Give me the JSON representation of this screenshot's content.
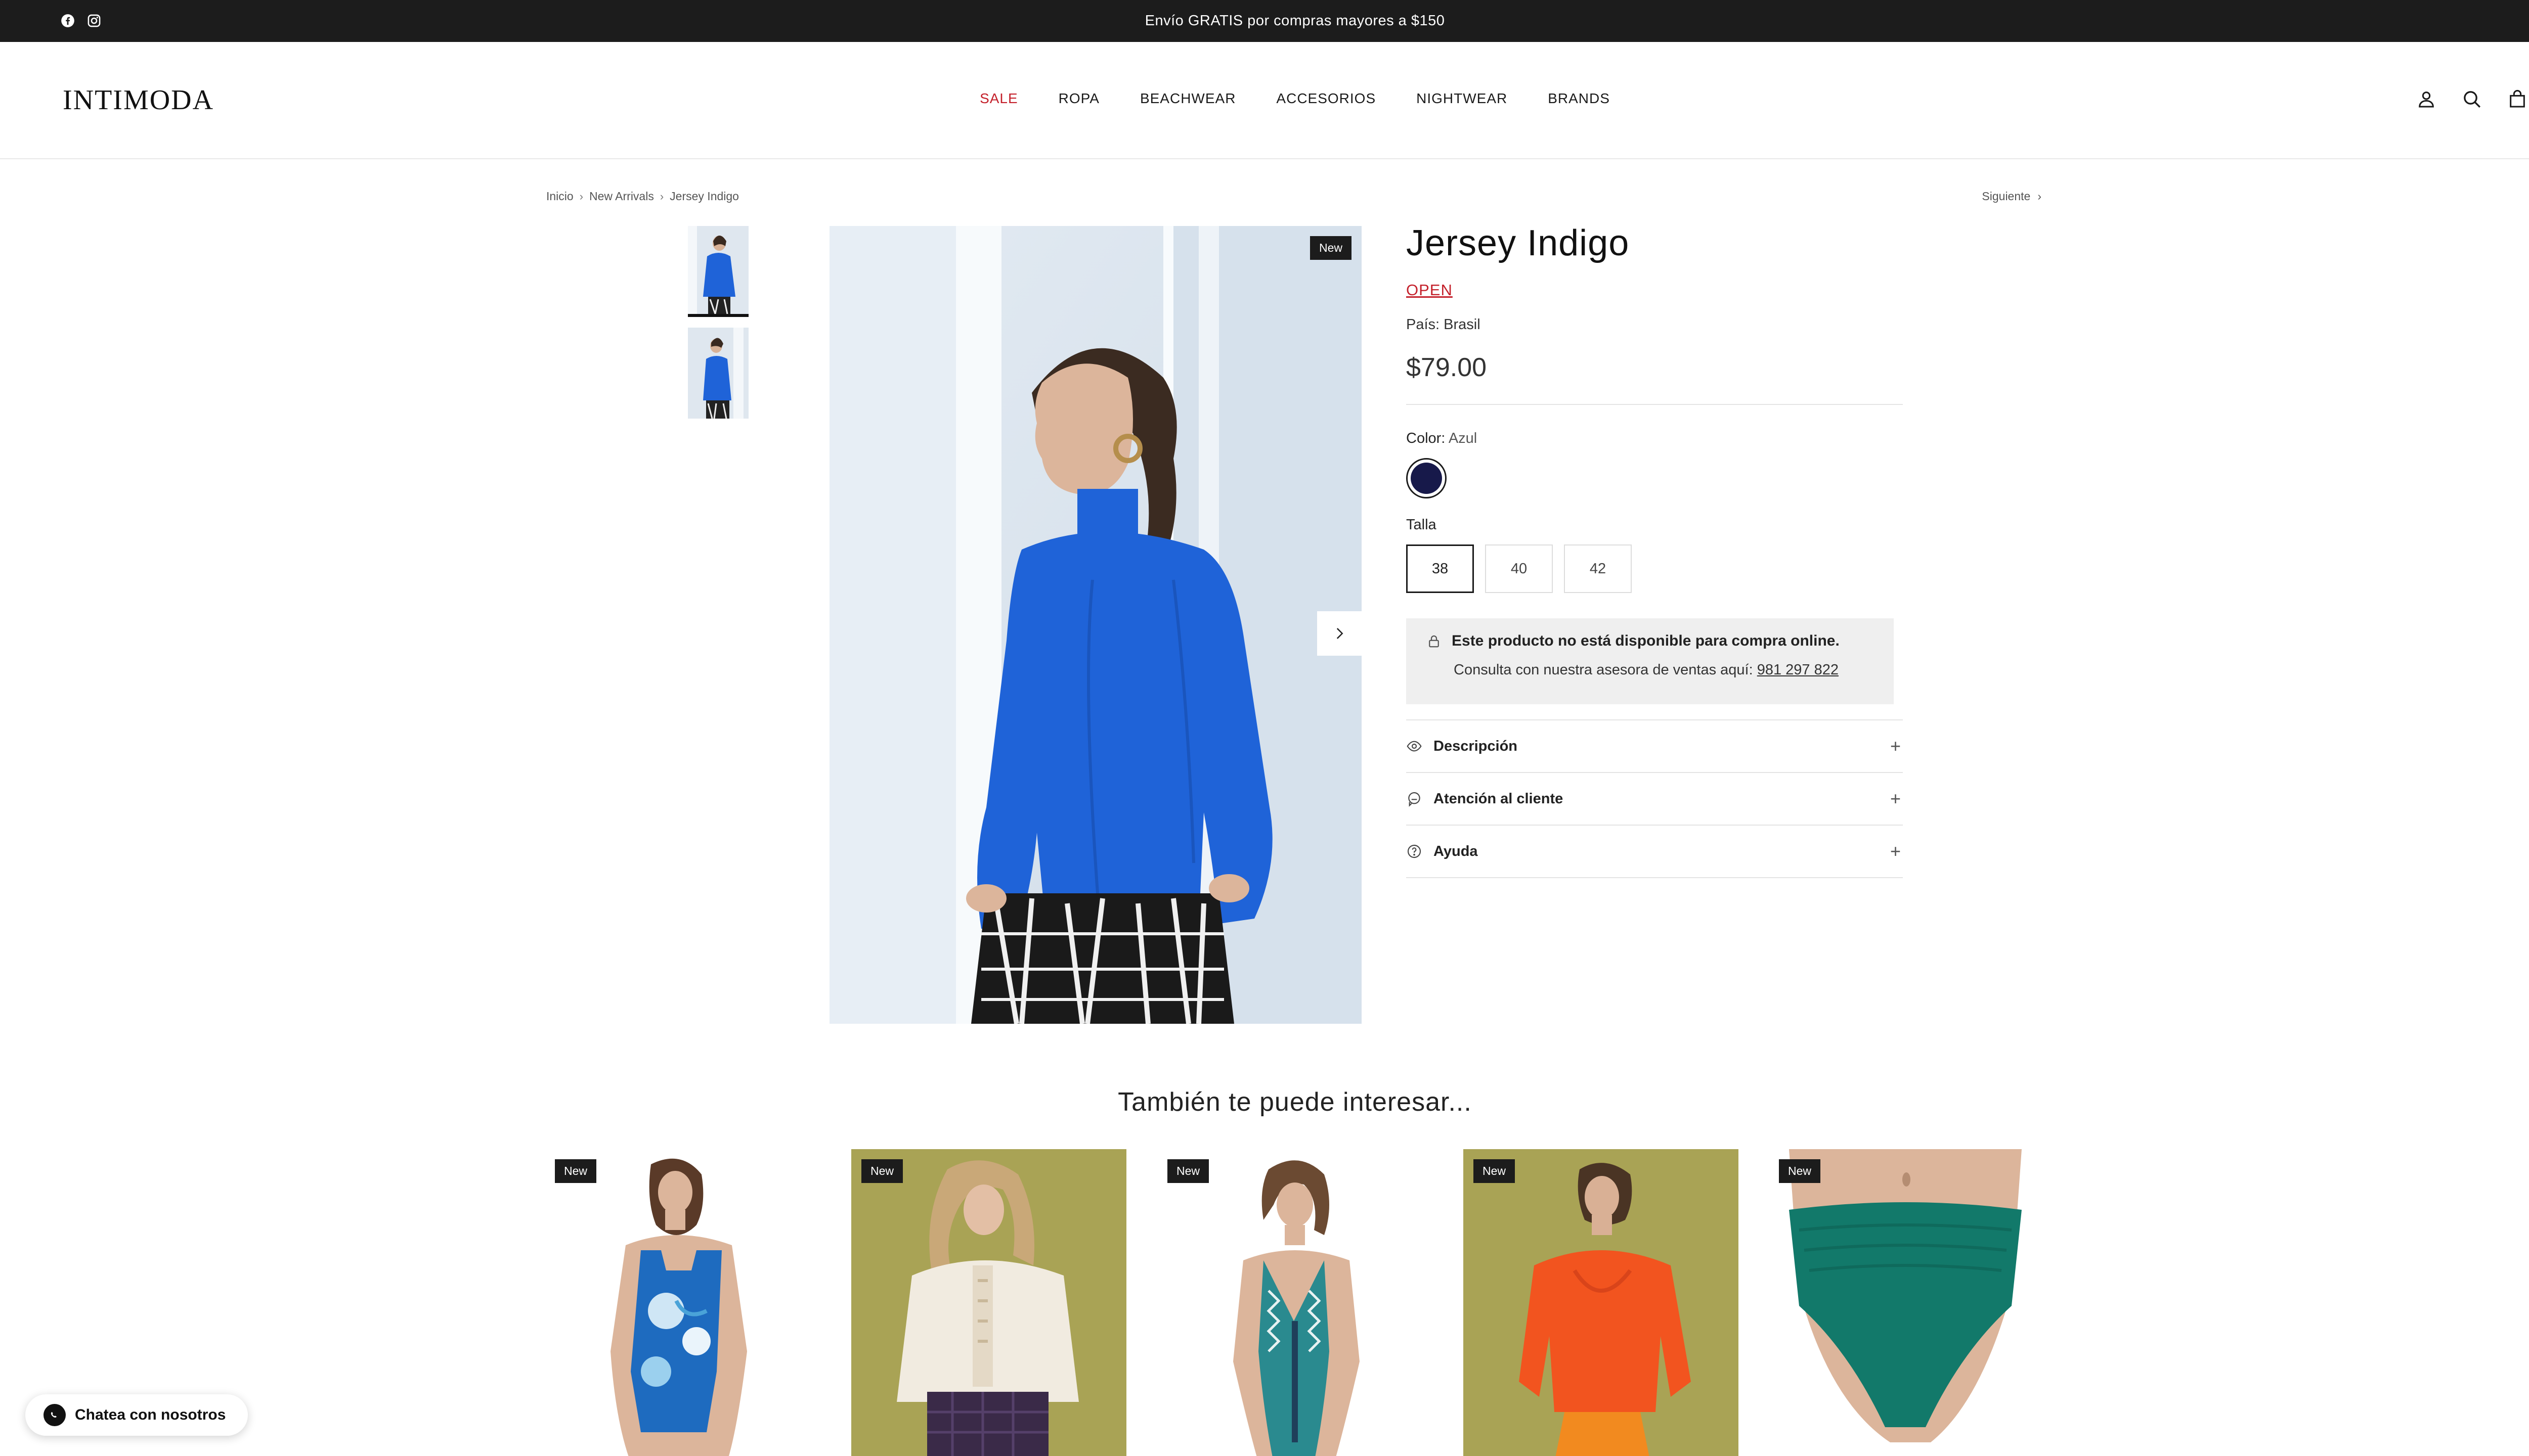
{
  "topbar": {
    "promo": "Envío GRATIS por compras mayores a $150",
    "social": [
      "facebook-icon",
      "instagram-icon"
    ]
  },
  "header": {
    "logo": "INTIMODA",
    "nav": [
      {
        "label": "SALE"
      },
      {
        "label": "ROPA"
      },
      {
        "label": "BEACHWEAR"
      },
      {
        "label": "ACCESORIOS"
      },
      {
        "label": "NIGHTWEAR"
      },
      {
        "label": "BRANDS"
      }
    ],
    "icons": [
      "account-icon",
      "search-icon",
      "cart-icon"
    ],
    "sale_color": "#c4202b"
  },
  "breadcrumb": {
    "items": [
      "Inicio",
      "New Arrivals",
      "Jersey Indigo"
    ],
    "next": "Siguiente"
  },
  "gallery": {
    "badge": "New"
  },
  "product": {
    "title": "Jersey Indigo",
    "brand": "OPEN",
    "origin": "País: Brasil",
    "price": "$79.00",
    "color_label": "Color:",
    "color_value": "Azul",
    "swatch_color": "#17194a",
    "size_label": "Talla",
    "sizes": [
      "38",
      "40",
      "42"
    ],
    "selected_size": "38",
    "notice_title": "Este producto no está disponible para compra online.",
    "notice_text": "Consulta con nuestra asesora de ventas aquí:",
    "notice_phone": "981 297 822",
    "accordion": [
      {
        "label": "Descripción"
      },
      {
        "label": "Atención al cliente"
      },
      {
        "label": "Ayuda"
      }
    ]
  },
  "related": {
    "title": "También te puede interesar...",
    "cards": [
      {
        "badge": "New"
      },
      {
        "badge": "New"
      },
      {
        "badge": "New"
      },
      {
        "badge": "New"
      },
      {
        "badge": "New"
      }
    ]
  },
  "chat": {
    "label": "Chatea con nosotros"
  }
}
